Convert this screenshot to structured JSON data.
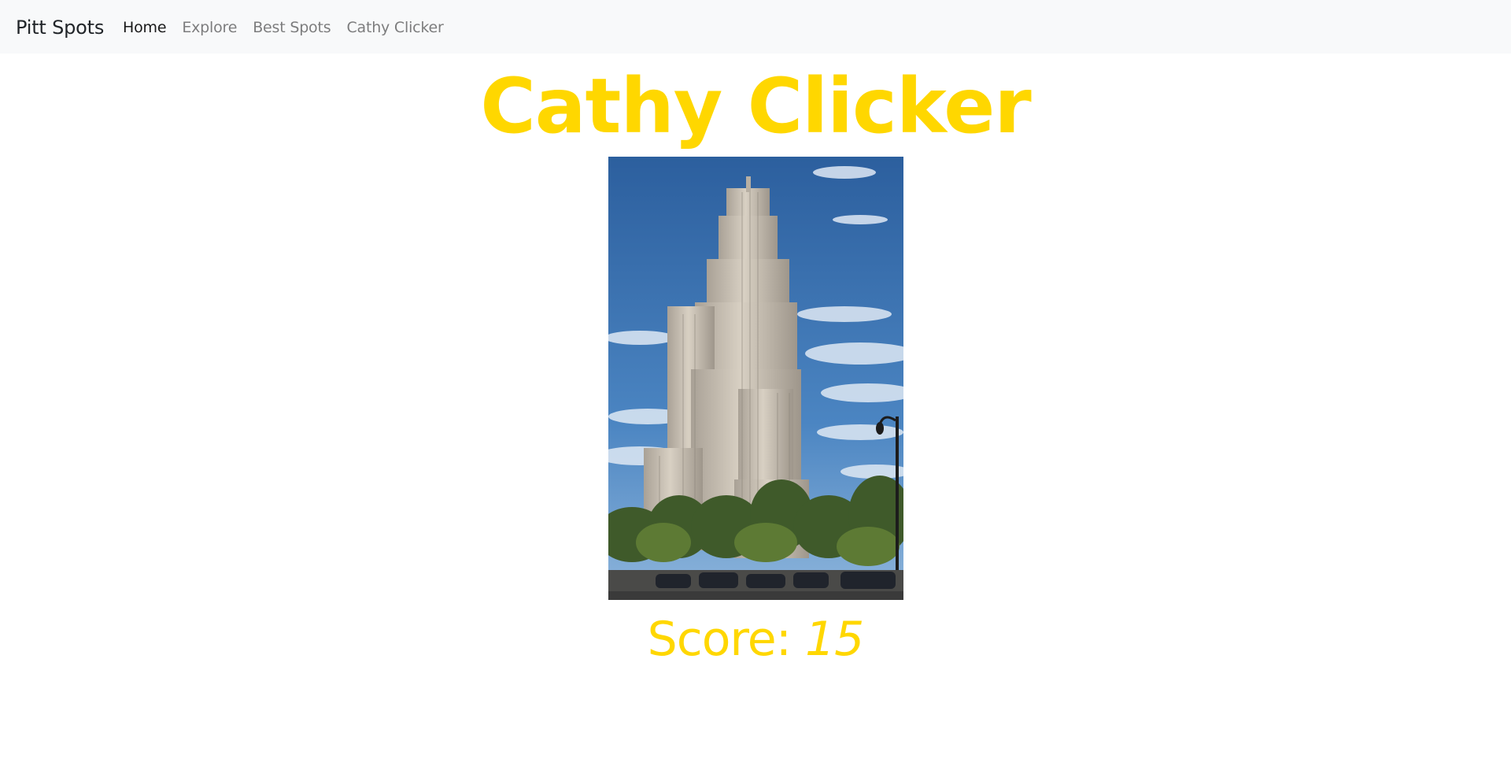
{
  "navbar": {
    "brand": "Pitt Spots",
    "links": [
      {
        "label": "Home",
        "active": true
      },
      {
        "label": "Explore",
        "active": false
      },
      {
        "label": "Best Spots",
        "active": false
      },
      {
        "label": "Cathy Clicker",
        "active": false
      }
    ]
  },
  "main": {
    "title": "Cathy Clicker",
    "image_subject": "cathedral-of-learning-photo",
    "score_label": "Score: ",
    "score_value": "15"
  },
  "colors": {
    "accent": "#ffd700",
    "navbar_bg": "#f8f9fa",
    "sky": "#3b6fae"
  }
}
